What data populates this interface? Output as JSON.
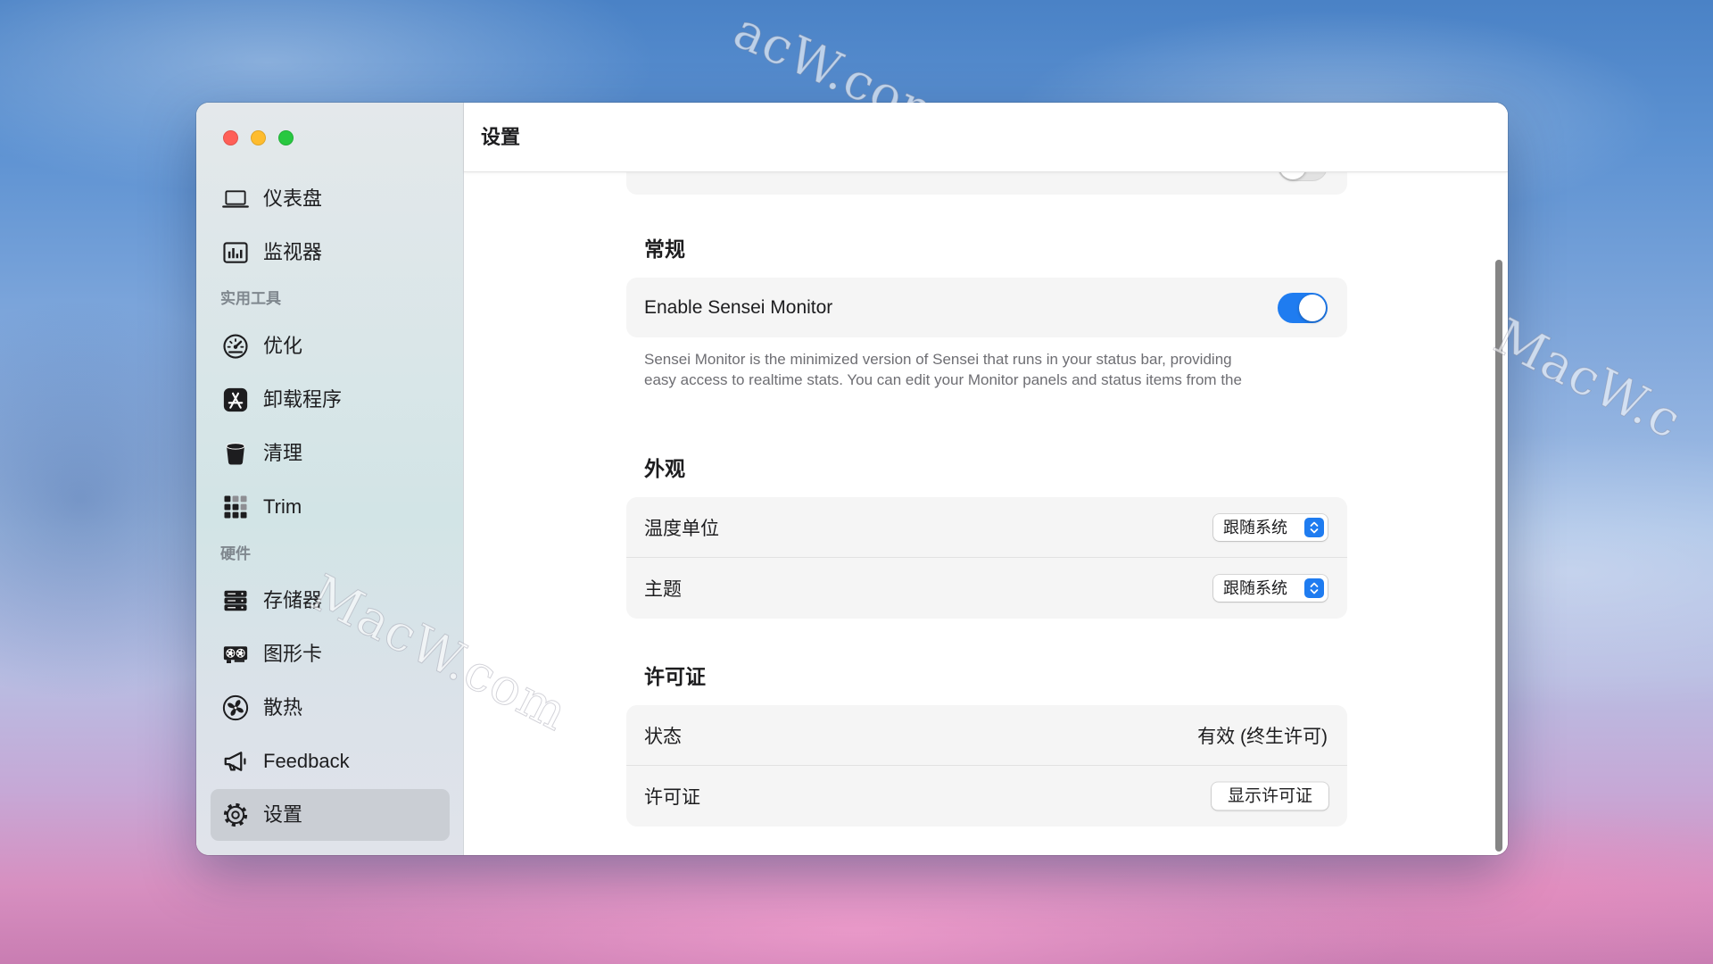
{
  "colors": {
    "accent": "#1f7cf0",
    "close": "#ff5f57",
    "minimize": "#febc2e",
    "zoom": "#28c840"
  },
  "sidebar": {
    "top_items": [
      {
        "label": "仪表盘",
        "icon": "laptop-icon"
      },
      {
        "label": "监视器",
        "icon": "chart-bars-icon"
      }
    ],
    "sections": [
      {
        "header": "实用工具",
        "items": [
          {
            "label": "优化",
            "icon": "gauge-icon"
          },
          {
            "label": "卸载程序",
            "icon": "app-store-icon"
          },
          {
            "label": "清理",
            "icon": "trash-bin-icon"
          },
          {
            "label": "Trim",
            "icon": "grid-icon"
          }
        ]
      },
      {
        "header": "硬件",
        "items": [
          {
            "label": "存储器",
            "icon": "storage-drives-icon"
          },
          {
            "label": "图形卡",
            "icon": "graphics-card-icon"
          },
          {
            "label": "散热",
            "icon": "fan-icon"
          }
        ]
      }
    ],
    "bottom_items": [
      {
        "label": "Feedback",
        "icon": "megaphone-icon"
      },
      {
        "label": "设置",
        "icon": "gear-icon",
        "selected": true
      }
    ]
  },
  "main": {
    "header_title": "设置",
    "general": {
      "heading": "常规",
      "enable_monitor_label": "Enable Sensei Monitor",
      "enable_monitor_on": true,
      "description_lines": [
        "Sensei Monitor is the minimized version of Sensei that runs in your status bar, providing",
        "easy access to realtime stats. You can edit your Monitor panels and status items from the"
      ]
    },
    "appearance": {
      "heading": "外观",
      "rows": [
        {
          "label": "温度单位",
          "value": "跟随系统"
        },
        {
          "label": "主题",
          "value": "跟随系统"
        }
      ]
    },
    "license": {
      "heading": "许可证",
      "status_label": "状态",
      "status_value": "有效 (终生许可)",
      "license_label": "许可证",
      "show_license_button": "显示许可证"
    }
  },
  "watermarks": [
    "acW.com",
    "MacW.com",
    "MacW.c"
  ]
}
